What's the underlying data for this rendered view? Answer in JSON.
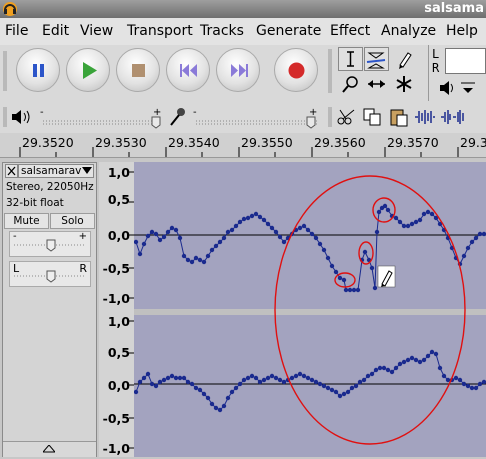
{
  "window": {
    "title": "salsama"
  },
  "menu": [
    "File",
    "Edit",
    "View",
    "Transport",
    "Tracks",
    "Generate",
    "Effect",
    "Analyze",
    "Help"
  ],
  "meter_labels": [
    "L",
    "R"
  ],
  "ruler": {
    "ticks": [
      "29.3520",
      "29.3530",
      "29.3540",
      "29.3550",
      "29.3560",
      "29.3570",
      "29.3"
    ]
  },
  "track": {
    "name": "salsamarav",
    "format": "Stereo, 22050Hz",
    "bits": "32-bit float",
    "mute": "Mute",
    "solo": "Solo",
    "gain_minus": "-",
    "gain_plus": "+",
    "pan_left": "L",
    "pan_right": "R"
  },
  "channels": [
    {
      "scale": [
        "1,0",
        "0,5",
        "0,0",
        "-0,5",
        "-1,0"
      ]
    },
    {
      "scale": [
        "1,0",
        "0,5",
        "0,0",
        "-0,5",
        "-1,0"
      ]
    }
  ],
  "colors": {
    "wave": "#1a2a8e",
    "wave_bg": "#a3a3bf",
    "annotation": "#e01010"
  }
}
